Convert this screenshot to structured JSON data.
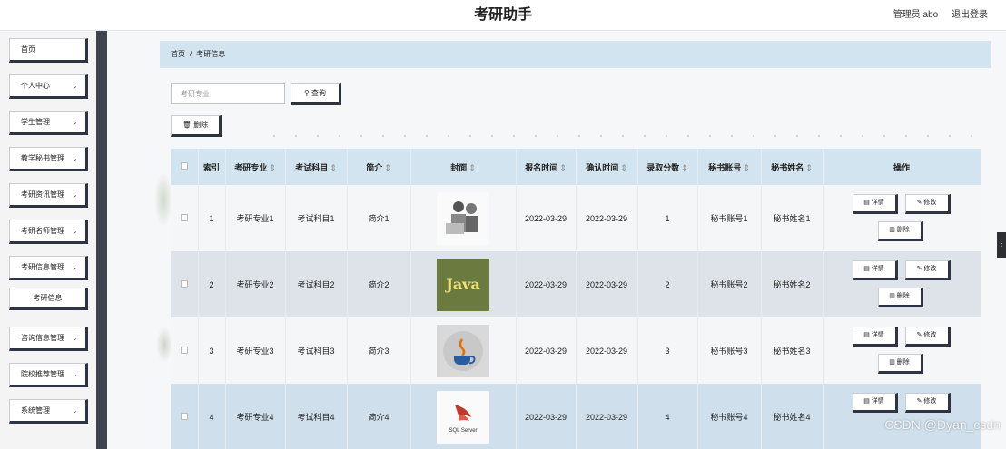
{
  "header": {
    "title": "考研助手",
    "user": "管理员 abo",
    "logout": "退出登录"
  },
  "sidebar": {
    "items": [
      {
        "label": "首页",
        "chevron": ""
      },
      {
        "label": "个人中心",
        "chevron": "⌄"
      },
      {
        "label": "学生管理",
        "chevron": "⌄"
      },
      {
        "label": "教学秘书管理",
        "chevron": "⌄"
      },
      {
        "label": "考研资讯管理",
        "chevron": "⌄"
      },
      {
        "label": "考研名师管理",
        "chevron": "⌄"
      },
      {
        "label": "考研信息管理",
        "chevron": "⌄"
      },
      {
        "label": "考研信息",
        "chevron": ""
      },
      {
        "label": "咨询信息管理",
        "chevron": "⌄"
      },
      {
        "label": "院校推荐管理",
        "chevron": "⌄"
      },
      {
        "label": "系统管理",
        "chevron": "⌄"
      }
    ]
  },
  "breadcrumb": {
    "home": "首页",
    "separator": "/",
    "current": "考研信息"
  },
  "search": {
    "placeholder": "考研专业",
    "button": "查询"
  },
  "toolbar": {
    "delete": "删除"
  },
  "table": {
    "columns": [
      "索引",
      "考研专业",
      "考试科目",
      "简介",
      "封面",
      "报名时间",
      "确认时间",
      "录取分数",
      "秘书账号",
      "秘书姓名",
      "操作"
    ],
    "rows": [
      {
        "index": "1",
        "major": "考研专业1",
        "subject": "考试科目1",
        "intro": "简介1",
        "cover": "people",
        "signup": "2022-03-29",
        "confirm": "2022-03-29",
        "score": "1",
        "account": "秘书账号1",
        "name": "秘书姓名1"
      },
      {
        "index": "2",
        "major": "考研专业2",
        "subject": "考试科目2",
        "intro": "简介2",
        "cover": "Java",
        "signup": "2022-03-29",
        "confirm": "2022-03-29",
        "score": "2",
        "account": "秘书账号2",
        "name": "秘书姓名2"
      },
      {
        "index": "3",
        "major": "考研专业3",
        "subject": "考试科目3",
        "intro": "简介3",
        "cover": "java-logo",
        "signup": "2022-03-29",
        "confirm": "2022-03-29",
        "score": "3",
        "account": "秘书账号3",
        "name": "秘书姓名3"
      },
      {
        "index": "4",
        "major": "考研专业4",
        "subject": "考试科目4",
        "intro": "简介4",
        "cover": "SQL Server",
        "signup": "2022-03-29",
        "confirm": "2022-03-29",
        "score": "4",
        "account": "秘书账号4",
        "name": "秘书姓名4"
      }
    ],
    "actions": {
      "detail": "详情",
      "edit": "修改",
      "delete": "删除"
    }
  },
  "watermark": "CSDN @Dyan_csdn",
  "side_tab": "‹"
}
